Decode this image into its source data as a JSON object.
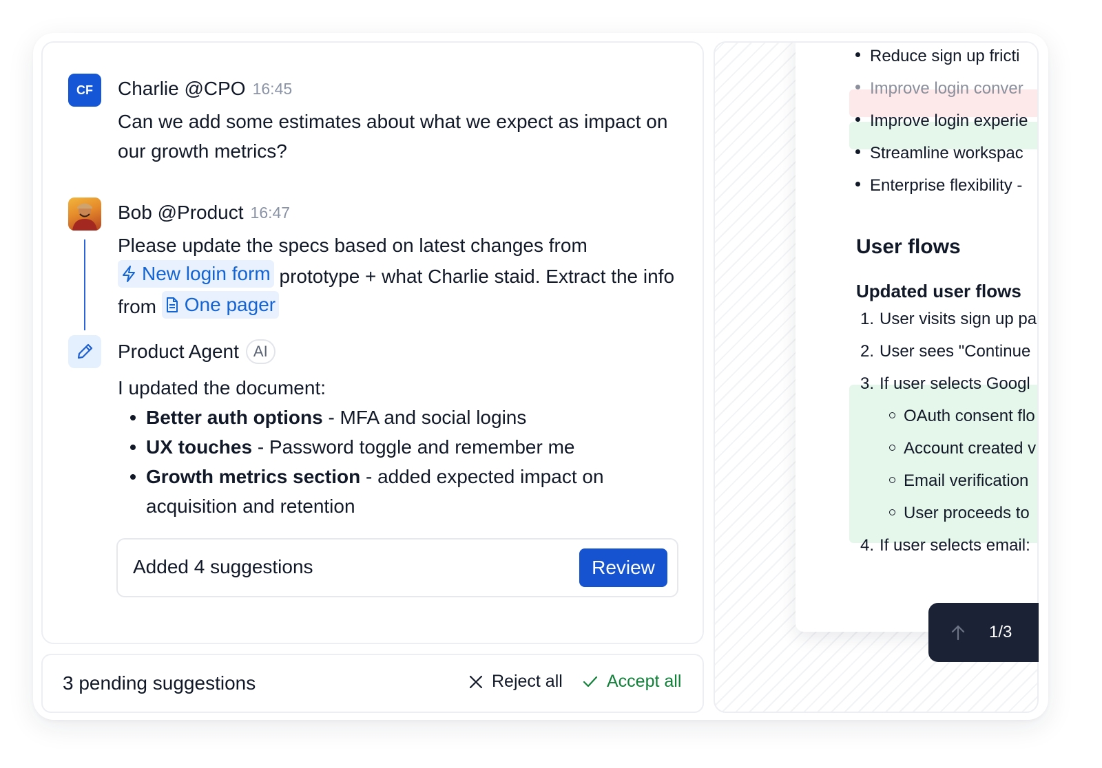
{
  "messages": [
    {
      "avatar_initials": "CF",
      "author": "Charlie @CPO",
      "time": "16:45",
      "text": "Can we add some estimates about what we expect as impact on our growth metrics?"
    },
    {
      "author": "Bob @Product",
      "time": "16:47",
      "text_1": "Please update the specs based on latest changes from",
      "link_1": "New login form",
      "text_2": "prototype + what Charlie staid. Extract the info from",
      "link_2": "One pager"
    },
    {
      "author": "Product Agent",
      "badge": "AI",
      "intro": "I updated the document:",
      "bullets": [
        {
          "title": "Better auth options",
          "desc": "- MFA and social logins"
        },
        {
          "title": "UX touches",
          "desc": "- Password toggle and remember me"
        },
        {
          "title": "Growth metrics section",
          "desc": "- added expected impact on acquisition and retention"
        }
      ],
      "suggestions_text": "Added 4 suggestions",
      "review_label": "Review"
    }
  ],
  "footer": {
    "pending_text": "3 pending suggestions",
    "reject_label": "Reject all",
    "accept_label": "Accept all"
  },
  "document": {
    "goals": [
      {
        "text": "Reduce sign up fricti",
        "state": "normal"
      },
      {
        "text": "Improve login conver",
        "state": "removed"
      },
      {
        "text": "Improve login experie",
        "state": "added"
      },
      {
        "text": "Streamline workspac",
        "state": "normal"
      },
      {
        "text": "Enterprise flexibility -",
        "state": "normal"
      }
    ],
    "section_title": "User flows",
    "subsection_title": "Updated user flows",
    "steps": [
      {
        "num": "1.",
        "text": "User visits sign up pa"
      },
      {
        "num": "2.",
        "text": "User sees \"Continue"
      },
      {
        "num": "3.",
        "text": "If user selects Googl"
      },
      {
        "num": "4.",
        "text": "If user selects email:"
      }
    ],
    "substeps": [
      "OAuth consent flo",
      "Account created v",
      "Email verification",
      "User proceeds to"
    ]
  },
  "pager": {
    "count": "1/3"
  },
  "colors": {
    "accent": "#1553d1",
    "link": "#1463d3",
    "accept": "#13803a",
    "removed_bg": "#fde8ea",
    "added_bg": "#e5f6ea",
    "pager_bg": "#1b2235"
  }
}
